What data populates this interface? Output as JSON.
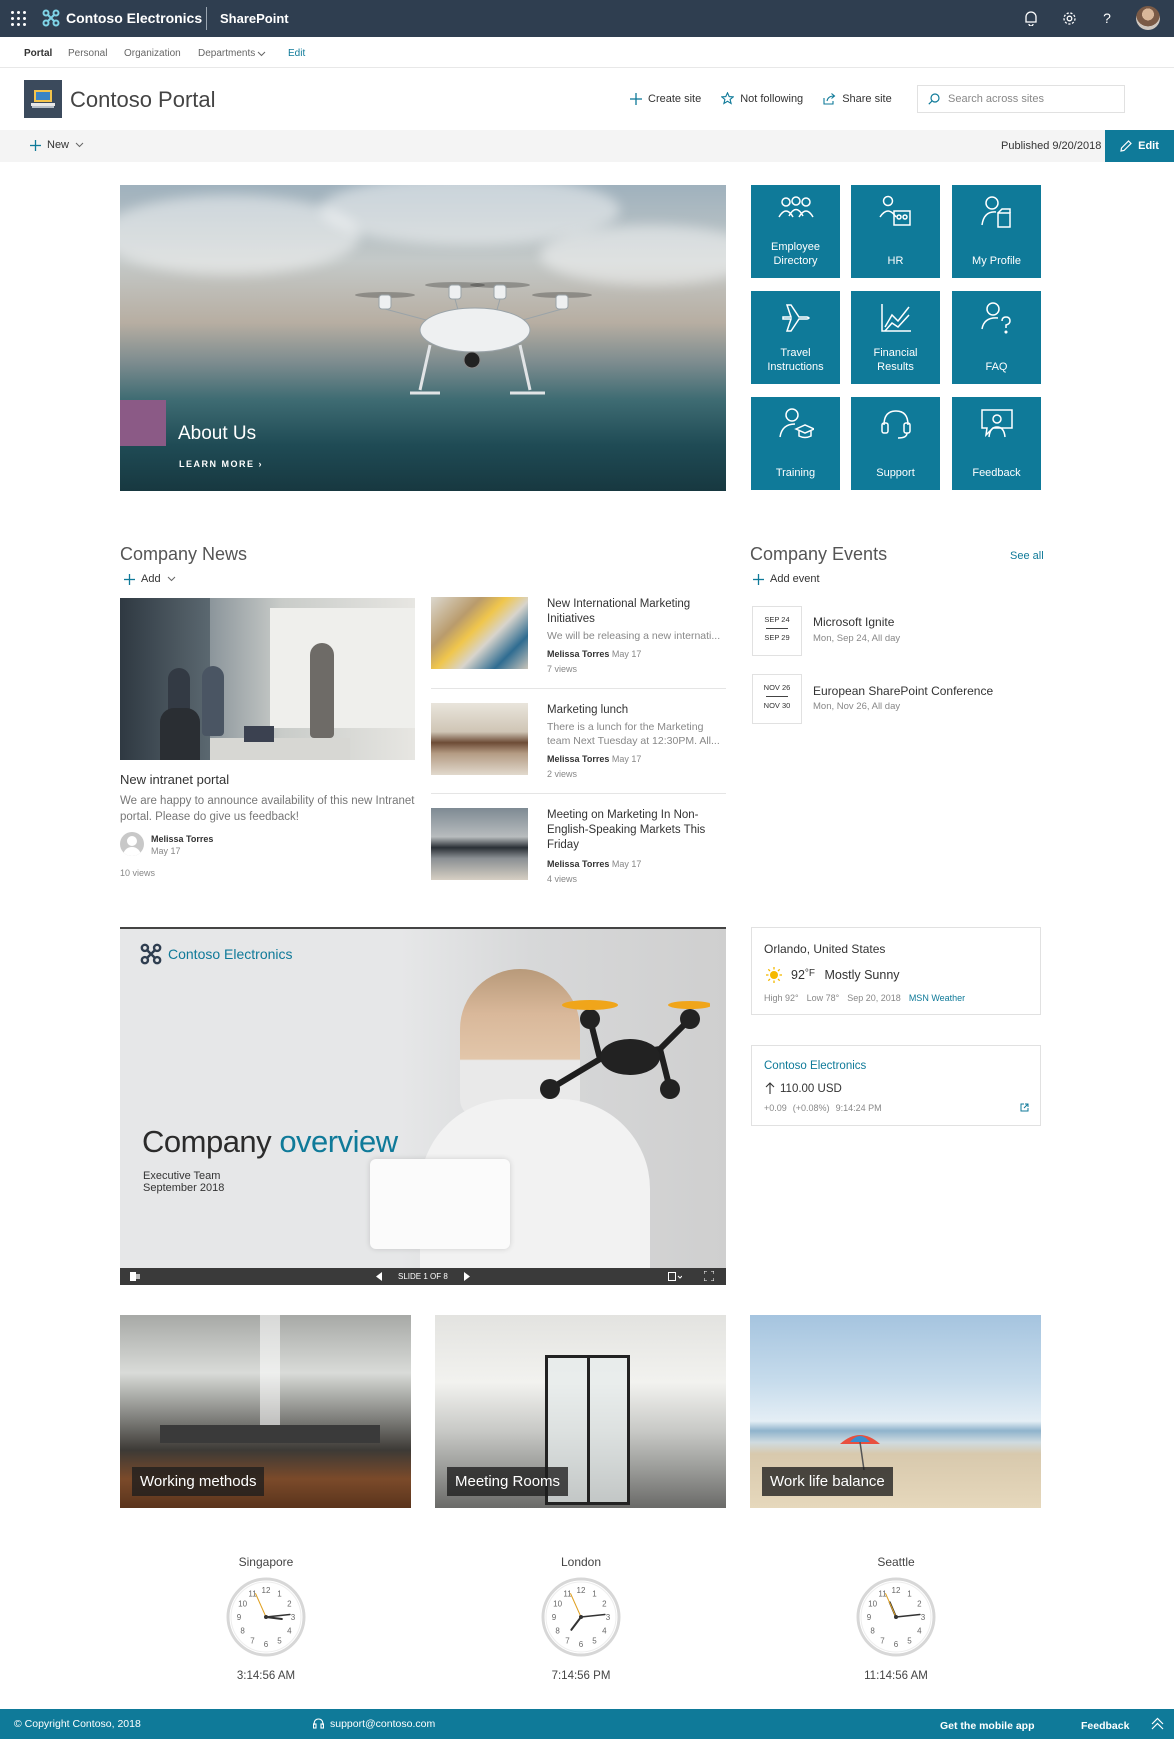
{
  "suite": {
    "brand": "Contoso Electronics",
    "product": "SharePoint"
  },
  "hubnav": {
    "items": [
      "Portal",
      "Personal",
      "Organization",
      "Departments",
      "Edit"
    ]
  },
  "header": {
    "title": "Contoso Portal",
    "actions": [
      "Create site",
      "Not following",
      "Share site"
    ],
    "search_placeholder": "Search across sites"
  },
  "cmdbar": {
    "new_label": "New",
    "published": "Published 9/20/2018",
    "edit_label": "Edit"
  },
  "hero": {
    "title": "About Us",
    "link": "LEARN MORE"
  },
  "quicklinks": [
    {
      "label": "Employee Directory",
      "icon": "people-icon"
    },
    {
      "label": "HR",
      "icon": "hr-icon"
    },
    {
      "label": "My Profile",
      "icon": "profile-icon"
    },
    {
      "label": "Travel Instructions",
      "icon": "airplane-icon"
    },
    {
      "label": "Financial Results",
      "icon": "chart-icon"
    },
    {
      "label": "FAQ",
      "icon": "question-person-icon"
    },
    {
      "label": "Training",
      "icon": "graduation-icon"
    },
    {
      "label": "Support",
      "icon": "headset-icon"
    },
    {
      "label": "Feedback",
      "icon": "feedback-icon"
    }
  ],
  "news": {
    "title": "Company News",
    "add_label": "Add",
    "main": {
      "title": "New intranet portal",
      "summary": "We are happy to announce availability of this new Intranet portal. Please do give us feedback!",
      "author": "Melissa Torres",
      "date": "May 17",
      "views": "10 views"
    },
    "items": [
      {
        "title": "New International Marketing Initiatives",
        "summary": "We will be releasing a new internati...",
        "author": "Melissa Torres",
        "date": "May 17",
        "views": "7 views"
      },
      {
        "title": "Marketing lunch",
        "summary": "There is a lunch for the Marketing team Next Tuesday at 12:30PM. All...",
        "author": "Melissa Torres",
        "date": "May 17",
        "views": "2 views"
      },
      {
        "title": "Meeting on Marketing In Non-English-Speaking Markets This Friday",
        "summary": "",
        "author": "Melissa Torres",
        "date": "May 17",
        "views": "4 views"
      }
    ]
  },
  "events": {
    "title": "Company Events",
    "see_all": "See all",
    "add_label": "Add event",
    "items": [
      {
        "start": "SEP 24",
        "end": "SEP 29",
        "title": "Microsoft Ignite",
        "when": "Mon, Sep 24, All day"
      },
      {
        "start": "NOV 26",
        "end": "NOV 30",
        "title": "European SharePoint Conference",
        "when": "Mon, Nov 26, All day"
      }
    ]
  },
  "deck": {
    "brand": "Contoso Electronics",
    "title_a": "Company",
    "title_b": "overview",
    "sub1": "Executive Team",
    "sub2": "September 2018",
    "slide": "SLIDE 1 OF 8"
  },
  "weather": {
    "location": "Orlando, United States",
    "temp": "92",
    "unit": "°F",
    "condition": "Mostly Sunny",
    "high": "High 92°",
    "low": "Low 78°",
    "date": "Sep 20, 2018",
    "source": "MSN Weather"
  },
  "stock": {
    "name": "Contoso Electronics",
    "price": "110.00 USD",
    "change": "+0.09",
    "change_pct": "(+0.08%)",
    "time": "9:14:24 PM"
  },
  "tiles": [
    {
      "label": "Working methods"
    },
    {
      "label": "Meeting Rooms"
    },
    {
      "label": "Work life balance"
    }
  ],
  "clocks": [
    {
      "city": "Singapore",
      "time": "3:14:56 AM"
    },
    {
      "city": "London",
      "time": "7:14:56 PM"
    },
    {
      "city": "Seattle",
      "time": "11:14:56 AM"
    }
  ],
  "footer": {
    "copyright": "© Copyright Contoso, 2018",
    "email": "support@contoso.com",
    "mobile": "Get the mobile app",
    "feedback": "Feedback"
  },
  "colors": {
    "suitebar": "#2f3e50",
    "accent": "#0f7a99",
    "hero_accent": "#8b5a86"
  }
}
